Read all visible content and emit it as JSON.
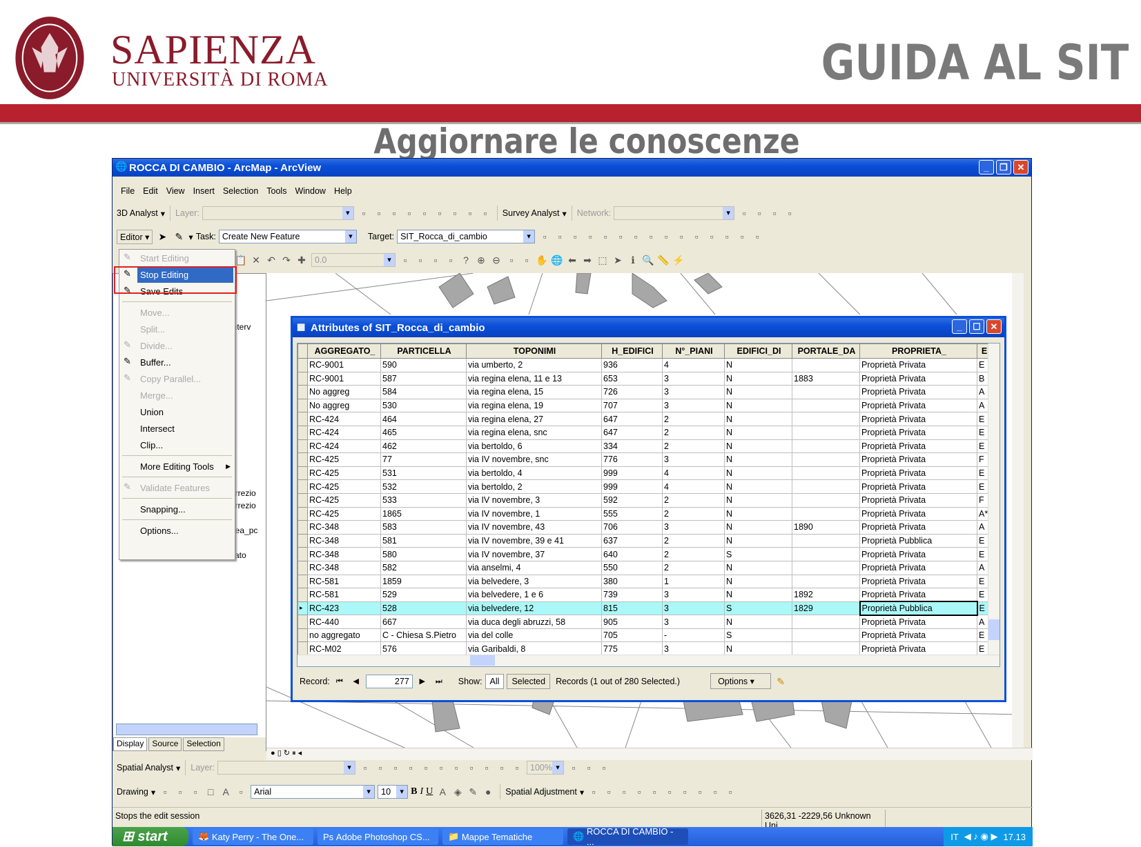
{
  "header": {
    "brand_name": "SAPIENZA",
    "brand_sub": "UNIVERSITÀ DI ROMA",
    "seal_text": "STVDIVM VRBIS",
    "guide_title": "GUIDA AL SIT",
    "slide_title": "Aggiornare le conoscenze",
    "brand_color": "#8a1b2b",
    "band_color": "#b8222e"
  },
  "window": {
    "title": "ROCCA DI CAMBIO - ArcMap - ArcView",
    "menu": [
      "File",
      "Edit",
      "View",
      "Insert",
      "Selection",
      "Tools",
      "Window",
      "Help"
    ],
    "toolbar1": {
      "analyst": "3D Analyst",
      "layer_label": "Layer:",
      "survey": "Survey Analyst",
      "network_label": "Network:"
    },
    "toolbar2": {
      "editor": "Editor",
      "task_label": "Task:",
      "task_value": "Create New Feature",
      "target_label": "Target:",
      "target_value": "SIT_Rocca_di_cambio"
    },
    "toolbar3": {
      "scale_value": "0.0"
    },
    "toolbar4": {
      "spatial": "Spatial Analyst",
      "layer_label": "Layer:",
      "zoom_value": "100%"
    },
    "toolbar5": {
      "drawing": "Drawing",
      "font_value": "Arial",
      "size_value": "10",
      "bold": "B",
      "italic": "I",
      "underline": "U",
      "spatial_adjustment": "Spatial Adjustment"
    },
    "status": {
      "message": "Stops the edit session",
      "coords": "3626,31  -2229,56 Unknown Uni"
    },
    "toc": {
      "fragments": [
        "interv",
        "orrezio",
        "orrezio",
        "nea_pc",
        "cato"
      ],
      "tabs": [
        "Display",
        "Source",
        "Selection"
      ]
    }
  },
  "editor_menu": [
    {
      "label": "Start Editing",
      "disabled": true,
      "icon": "pencil-icon"
    },
    {
      "label": "Stop Editing",
      "highlighted": true,
      "icon": "stop-edit-icon"
    },
    {
      "label": "Save Edits",
      "icon": "save-edits-icon"
    },
    {
      "sep": true
    },
    {
      "label": "Move...",
      "disabled": true
    },
    {
      "label": "Split...",
      "disabled": true
    },
    {
      "label": "Divide...",
      "disabled": true,
      "icon": "divide-icon"
    },
    {
      "label": "Buffer...",
      "icon": "buffer-icon"
    },
    {
      "label": "Copy Parallel...",
      "disabled": true,
      "icon": "copy-parallel-icon"
    },
    {
      "label": "Merge...",
      "disabled": true
    },
    {
      "label": "Union"
    },
    {
      "label": "Intersect"
    },
    {
      "label": "Clip..."
    },
    {
      "sep": true
    },
    {
      "label": "More Editing Tools",
      "submenu": true
    },
    {
      "sep": true
    },
    {
      "label": "Validate Features",
      "disabled": true,
      "icon": "validate-icon"
    },
    {
      "sep": true
    },
    {
      "label": "Snapping..."
    },
    {
      "sep": true
    },
    {
      "label": "Options..."
    }
  ],
  "attributes": {
    "title": "Attributes of SIT_Rocca_di_cambio",
    "columns": [
      "AGGREGATO_",
      "PARTICELLA",
      "TOPONIMI",
      "H_EDIFICI",
      "N°_PIANI",
      "EDIFICI_DI",
      "PORTALE_DA",
      "PROPRIETA_",
      "E"
    ],
    "rows": [
      [
        "RC-9001",
        "590",
        "via umberto, 2",
        "936",
        "4",
        "N",
        "",
        "Proprietà Privata",
        "E"
      ],
      [
        "RC-9001",
        "587",
        "via regina elena, 11 e 13",
        "653",
        "3",
        "N",
        "1883",
        "Proprietà Privata",
        "B"
      ],
      [
        "No aggreg",
        "584",
        "via regina elena, 15",
        "726",
        "3",
        "N",
        "",
        "Proprietà Privata",
        "A"
      ],
      [
        "No aggreg",
        "530",
        "via regina elena, 19",
        "707",
        "3",
        "N",
        "",
        "Proprietà Privata",
        "A"
      ],
      [
        "RC-424",
        "464",
        "via regina elena, 27",
        "647",
        "2",
        "N",
        "",
        "Proprietà Privata",
        "E"
      ],
      [
        "RC-424",
        "465",
        "via regina elena, snc",
        "647",
        "2",
        "N",
        "",
        "Proprietà Privata",
        "E"
      ],
      [
        "RC-424",
        "462",
        "via bertoldo, 6",
        "334",
        "2",
        "N",
        "",
        "Proprietà Privata",
        "E"
      ],
      [
        "RC-425",
        "77",
        "via IV novembre, snc",
        "776",
        "3",
        "N",
        "",
        "Proprietà Privata",
        "F"
      ],
      [
        "RC-425",
        "531",
        "via bertoldo, 4",
        "999",
        "4",
        "N",
        "",
        "Proprietà Privata",
        "E"
      ],
      [
        "RC-425",
        "532",
        "via bertoldo, 2",
        "999",
        "4",
        "N",
        "",
        "Proprietà Privata",
        "E"
      ],
      [
        "RC-425",
        "533",
        "via IV novembre, 3",
        "592",
        "2",
        "N",
        "",
        "Proprietà Privata",
        "F"
      ],
      [
        "RC-425",
        "1865",
        "via IV novembre, 1",
        "555",
        "2",
        "N",
        "",
        "Proprietà Privata",
        "A*"
      ],
      [
        "RC-348",
        "583",
        "via IV novembre, 43",
        "706",
        "3",
        "N",
        "1890",
        "Proprietà Privata",
        "A"
      ],
      [
        "RC-348",
        "581",
        "via IV novembre, 39 e 41",
        "637",
        "2",
        "N",
        "",
        "Proprietà Pubblica",
        "E"
      ],
      [
        "RC-348",
        "580",
        "via IV novembre, 37",
        "640",
        "2",
        "S",
        "",
        "Proprietà Privata",
        "E"
      ],
      [
        "RC-348",
        "582",
        "via anselmi, 4",
        "550",
        "2",
        "N",
        "",
        "Proprietà Privata",
        "A"
      ],
      [
        "RC-581",
        "1859",
        "via belvedere, 3",
        "380",
        "1",
        "N",
        "",
        "Proprietà Privata",
        "E"
      ],
      [
        "RC-581",
        "529",
        "via belvedere, 1 e 6",
        "739",
        "3",
        "N",
        "1892",
        "Proprietà Privata",
        "E"
      ],
      [
        "RC-423",
        "528",
        "via belvedere, 12",
        "815",
        "3",
        "S",
        "1829",
        "Proprietà Pubblica",
        "E"
      ],
      [
        "RC-440",
        "667",
        "via duca degli abruzzi, 58",
        "905",
        "3",
        "N",
        "",
        "Proprietà Privata",
        "A"
      ],
      [
        "no aggregato",
        "C - Chiesa S.Pietro",
        "via del colle",
        "705",
        "-",
        "S",
        "",
        "Proprietà Privata",
        "E"
      ],
      [
        "RC-M02",
        "576",
        "via Garibaldi, 8",
        "775",
        "3",
        "N",
        "",
        "Proprietà Privata",
        "E"
      ]
    ],
    "selected_row": 18,
    "footer": {
      "record_label": "Record:",
      "record_value": "277",
      "show_label": "Show:",
      "all": "All",
      "selected": "Selected",
      "summary": "Records  (1 out of 280 Selected.)",
      "options": "Options"
    },
    "highlight_color": "#aaf8f8"
  },
  "taskbar": {
    "start": "start",
    "items": [
      "Katy Perry - The One...",
      "Adobe Photoshop CS...",
      "Mappe Tematiche",
      "ROCCA DI CAMBIO - ..."
    ],
    "lang": "IT",
    "clock": "17.13"
  }
}
